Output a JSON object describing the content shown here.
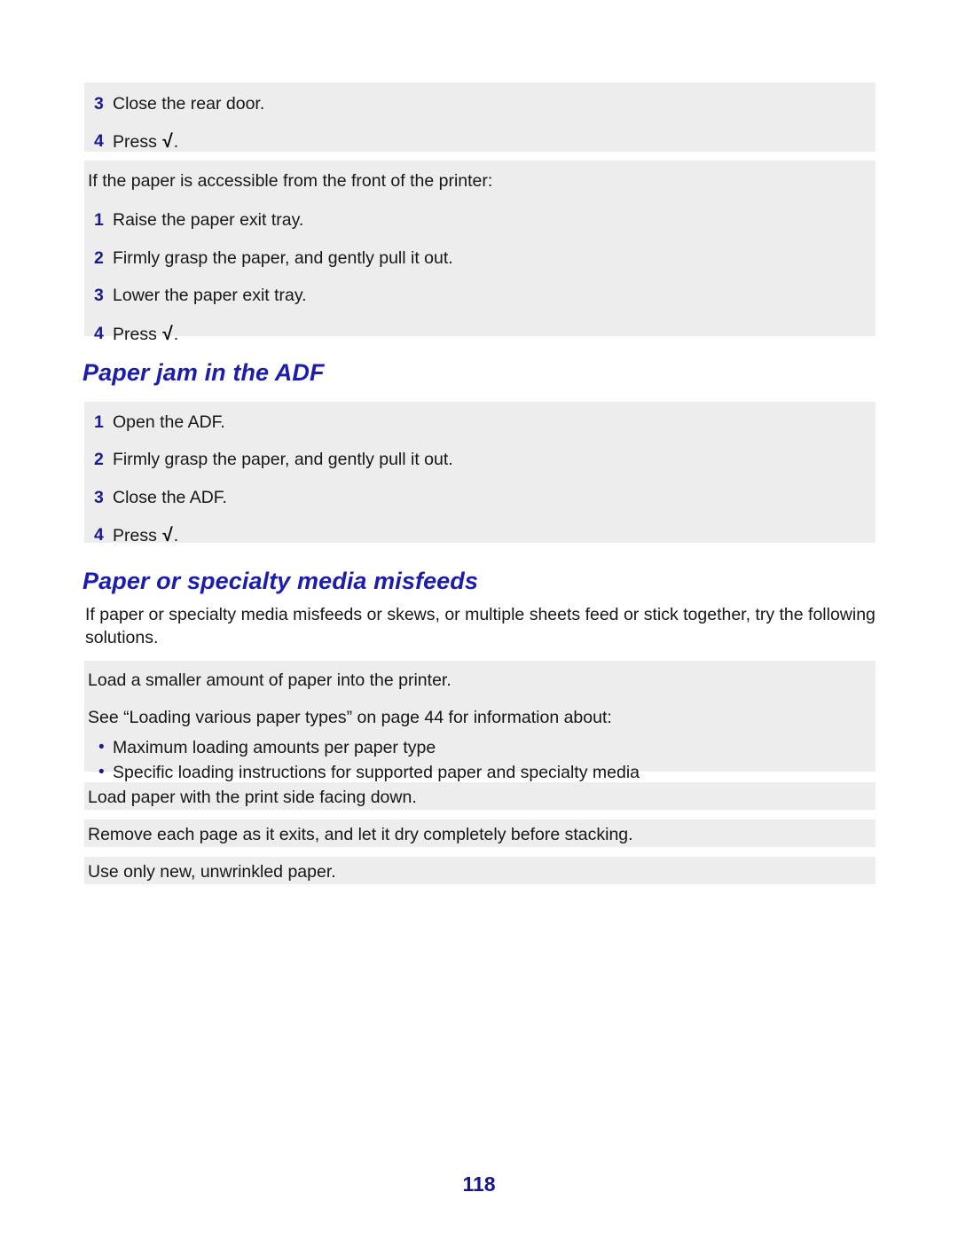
{
  "document": {
    "page_number": "118",
    "accent_heading_color": "#1d1dad",
    "step_number_color": "#1b1b8f",
    "band_background_color": "#ededed",
    "page_background_color": "#ffffff"
  },
  "block_rear_door": {
    "steps": [
      {
        "num": "3",
        "text": "Close the rear door."
      },
      {
        "num": "4",
        "text_before": "Press ",
        "glyph": "√",
        "text_after": "."
      }
    ]
  },
  "block_front_access": {
    "intro": "If the paper is accessible from the front of the printer:",
    "steps": [
      {
        "num": "1",
        "text": "Raise the paper exit tray."
      },
      {
        "num": "2",
        "text": "Firmly grasp the paper, and gently pull it out."
      },
      {
        "num": "3",
        "text": "Lower the paper exit tray."
      },
      {
        "num": "4",
        "text_before": "Press ",
        "glyph": "√",
        "text_after": "."
      }
    ]
  },
  "heading_adf": {
    "title": "Paper jam in the ADF"
  },
  "block_adf": {
    "steps": [
      {
        "num": "1",
        "text": "Open the ADF."
      },
      {
        "num": "2",
        "text": "Firmly grasp the paper, and gently pull it out."
      },
      {
        "num": "3",
        "text": "Close the ADF."
      },
      {
        "num": "4",
        "text_before": "Press ",
        "glyph": "√",
        "text_after": "."
      }
    ]
  },
  "heading_misfeeds": {
    "title": "Paper or specialty media misfeeds"
  },
  "intro_paragraph": {
    "text": "If paper or specialty media misfeeds or skews, or multiple sheets feed or stick together, try the following solutions."
  },
  "solution_loading": {
    "line1": "Load a smaller amount of paper into the printer.",
    "line2": "See “Loading various paper types” on page 44 for information about:",
    "bullet_glyph": "•",
    "bullets": [
      "Maximum loading amounts per paper type",
      "Specific loading instructions for supported paper and specialty media"
    ]
  },
  "solution_print_side": {
    "text": "Load paper with the print side facing down."
  },
  "solution_remove_page": {
    "text": "Remove each page as it exits, and let it dry completely before stacking."
  },
  "solution_new_paper": {
    "text": "Use only new, unwrinkled paper."
  }
}
